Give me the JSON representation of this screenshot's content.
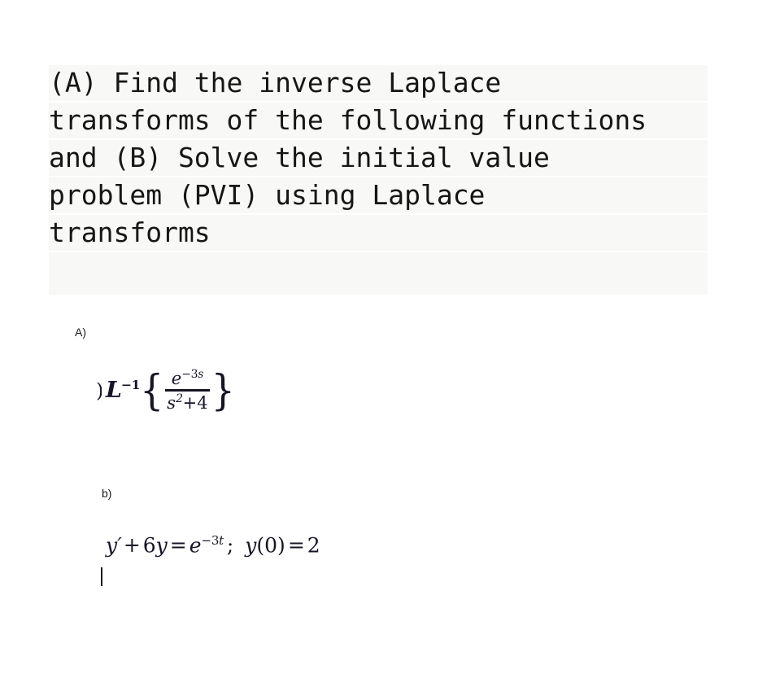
{
  "document": {
    "background_color": "#ffffff",
    "prompt": {
      "highlight_color": "#f8f8f7",
      "text_color": "#161616",
      "lines": [
        "(A) Find the inverse Laplace",
        "transforms of the following functions",
        "and (B) Solve the initial value",
        "problem (PVI) using Laplace",
        "transforms"
      ],
      "full_text": "(A) Find the inverse Laplace transforms of the following functions and (B) Solve the initial value problem (PVI) using Laplace transforms"
    },
    "answer": {
      "math_color": "#151526",
      "label_color": "#1b1b1b",
      "parts": [
        {
          "label": "A)",
          "leading_marker": ")",
          "expression_plain": "L^-1 { e^(-3s) / (s^2+4) }",
          "operator": "L",
          "operator_superscript": "−1",
          "open_brace": "{",
          "close_brace": "}",
          "numerator_base": "e",
          "numerator_exponent_sign": "−",
          "numerator_exponent_coefficient": "3",
          "numerator_exponent_variable": "s",
          "denominator_variable": "s",
          "denominator_power": "2",
          "denominator_plus": "+",
          "denominator_constant": "4"
        },
        {
          "label": "b)",
          "expression_plain": "y' + 6y = e^(-3t) ; y(0) = 2",
          "lhs_variable": "y",
          "lhs_prime": "′",
          "plus": "+",
          "coefficient": "6",
          "coefficient_variable": "y",
          "equals": "=",
          "rhs_base": "e",
          "rhs_exponent_sign": "−",
          "rhs_exponent_coefficient": "3",
          "rhs_exponent_variable": "t",
          "separator": ";",
          "initial_condition_variable": "y",
          "initial_condition_open": "(",
          "initial_condition_point": "0",
          "initial_condition_close": ")",
          "initial_condition_equals": "=",
          "initial_condition_value": "2"
        }
      ]
    },
    "caret": {
      "visible": true,
      "color": "#1b1b1b"
    }
  }
}
